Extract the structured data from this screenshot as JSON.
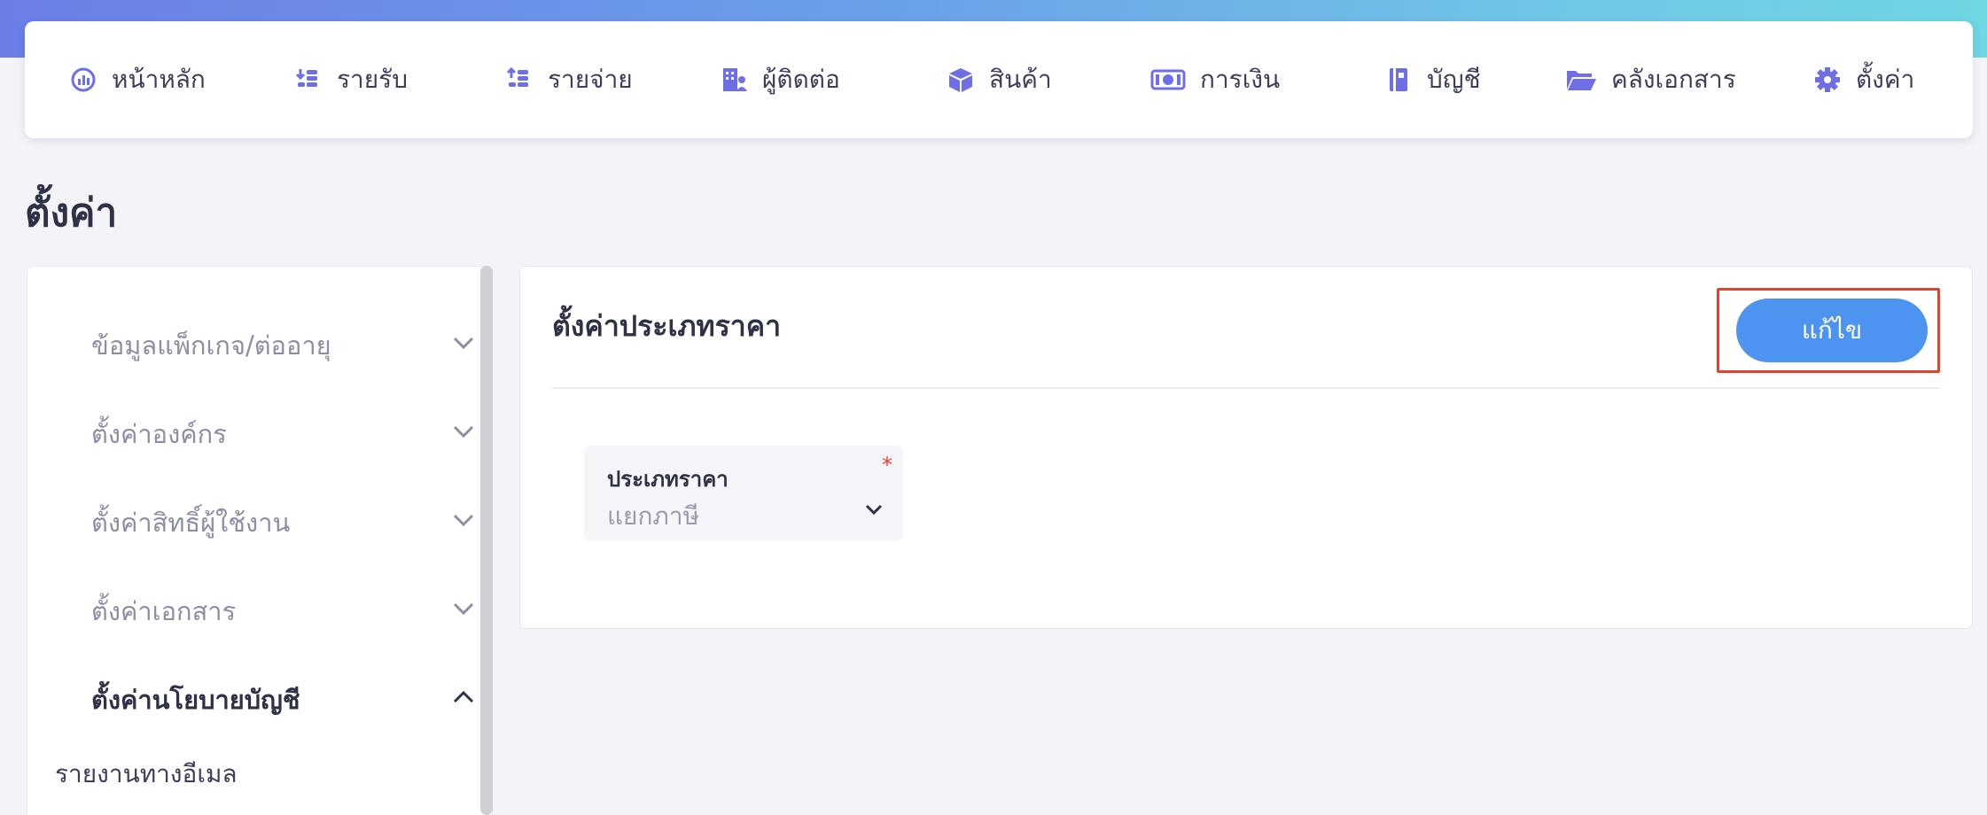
{
  "nav": {
    "items": [
      {
        "label": "หน้าหลัก",
        "icon": "dashboard-gauge-icon"
      },
      {
        "label": "รายรับ",
        "icon": "income-coins-icon"
      },
      {
        "label": "รายจ่าย",
        "icon": "expense-coins-icon"
      },
      {
        "label": "ผู้ติดต่อ",
        "icon": "contacts-building-icon"
      },
      {
        "label": "สินค้า",
        "icon": "product-box-icon"
      },
      {
        "label": "การเงิน",
        "icon": "money-banknote-icon"
      },
      {
        "label": "บัญชี",
        "icon": "accounting-book-icon"
      },
      {
        "label": "คลังเอกสาร",
        "icon": "documents-folder-icon"
      },
      {
        "label": "ตั้งค่า",
        "icon": "settings-gear-icon"
      }
    ]
  },
  "page": {
    "title": "ตั้งค่า"
  },
  "sidebar": {
    "items": [
      {
        "label": "ข้อมูลแพ็กเกจ/ต่ออายุ",
        "expanded": false
      },
      {
        "label": "ตั้งค่าองค์กร",
        "expanded": false
      },
      {
        "label": "ตั้งค่าสิทธิ์ผู้ใช้งาน",
        "expanded": false
      },
      {
        "label": "ตั้งค่าเอกสาร",
        "expanded": false
      },
      {
        "label": "ตั้งค่านโยบายบัญชี",
        "expanded": true
      }
    ],
    "sub_items": [
      {
        "label": "รายงานทางอีเมล"
      }
    ]
  },
  "card": {
    "title": "ตั้งค่าประเภทราคา",
    "edit_label": "แก้ไข",
    "field": {
      "label": "ประเภทราคา",
      "required_mark": "*",
      "value": "แยกภาษี"
    }
  },
  "colors": {
    "accent": "#4d93f0",
    "icon": "#6e6fe6",
    "highlight_frame": "#e0432e",
    "text_dark": "#2f3247",
    "text_muted": "#8c8ea3"
  }
}
